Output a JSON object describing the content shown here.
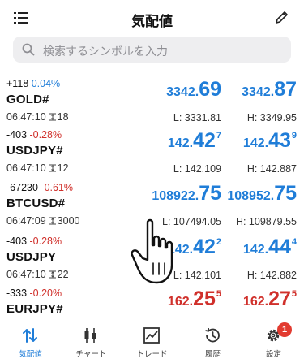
{
  "header": {
    "title": "気配値"
  },
  "search": {
    "placeholder": "検索するシンボルを入力"
  },
  "quotes": [
    {
      "change": "+118",
      "pct": "0.04%",
      "symbol": "GOLD#",
      "time": "06:47:10",
      "spread": "18",
      "bid": {
        "prefix": "3342.",
        "big": "69",
        "sup": ""
      },
      "ask": {
        "prefix": "3342.",
        "big": "87",
        "sup": ""
      },
      "low": "L: 3331.81",
      "high": "H: 3349.95",
      "color": "#1f7dd8"
    },
    {
      "change": "-403",
      "pct": "-0.28%",
      "symbol": "USDJPY#",
      "time": "06:47:10",
      "spread": "12",
      "bid": {
        "prefix": "142.",
        "big": "42",
        "sup": "7"
      },
      "ask": {
        "prefix": "142.",
        "big": "43",
        "sup": "9"
      },
      "low": "L: 142.109",
      "high": "H: 142.887",
      "color": "#1f7dd8"
    },
    {
      "change": "-67230",
      "pct": "-0.61%",
      "symbol": "BTCUSD#",
      "time": "06:47:09",
      "spread": "3000",
      "bid": {
        "prefix": "108922.",
        "big": "75",
        "sup": ""
      },
      "ask": {
        "prefix": "108952.",
        "big": "75",
        "sup": ""
      },
      "low": "L: 107494.05",
      "high": "H: 109879.55",
      "color": "#1f7dd8"
    },
    {
      "change": "-403",
      "pct": "-0.28%",
      "symbol": "USDJPY",
      "time": "06:47:10",
      "spread": "22",
      "bid": {
        "prefix": "142.",
        "big": "42",
        "sup": "2"
      },
      "ask": {
        "prefix": "142.",
        "big": "44",
        "sup": "4"
      },
      "low": "L: 142.101",
      "high": "H: 142.882",
      "color": "#1f7dd8"
    },
    {
      "change": "-333",
      "pct": "-0.20%",
      "symbol": "EURJPY#",
      "time": "",
      "spread": "",
      "bid": {
        "prefix": "162.",
        "big": "25",
        "sup": "5"
      },
      "ask": {
        "prefix": "162.",
        "big": "27",
        "sup": "5"
      },
      "low": "",
      "high": "",
      "color": "#d0302b"
    }
  ],
  "tabs": [
    {
      "label": "気配値",
      "icon": "arrows-updown-icon",
      "active": true
    },
    {
      "label": "チャート",
      "icon": "candlestick-icon",
      "active": false
    },
    {
      "label": "トレード",
      "icon": "trade-chart-icon",
      "active": false
    },
    {
      "label": "履歴",
      "icon": "history-clock-icon",
      "active": false
    },
    {
      "label": "設定",
      "icon": "gear-icon",
      "active": false,
      "badge": "1"
    }
  ],
  "colors": {
    "accent": "#1f7dd8",
    "down": "#d0302b",
    "badge": "#e23b30"
  }
}
